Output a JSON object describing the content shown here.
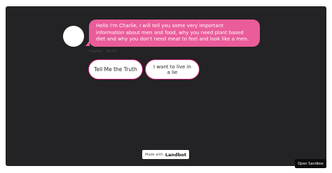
{
  "chat": {
    "bot_message": "Hello I'm Charlie, I will tell you some very important information about men and food, why you need plant based diet and why you don't need meat to feel and look like a men.",
    "bot_meta": "Charlie · 14:03"
  },
  "options": {
    "truth_label": "Tell Me the Truth",
    "lie_label": "I want to live in a lie"
  },
  "footer": {
    "made_with_label": "Made with",
    "brand_name": "Landbot"
  },
  "sandbox": {
    "open_label": "Open Sandbox"
  },
  "colors": {
    "background": "#232225",
    "bubble": "#ea5c9a",
    "option_border": "#c41f72"
  }
}
